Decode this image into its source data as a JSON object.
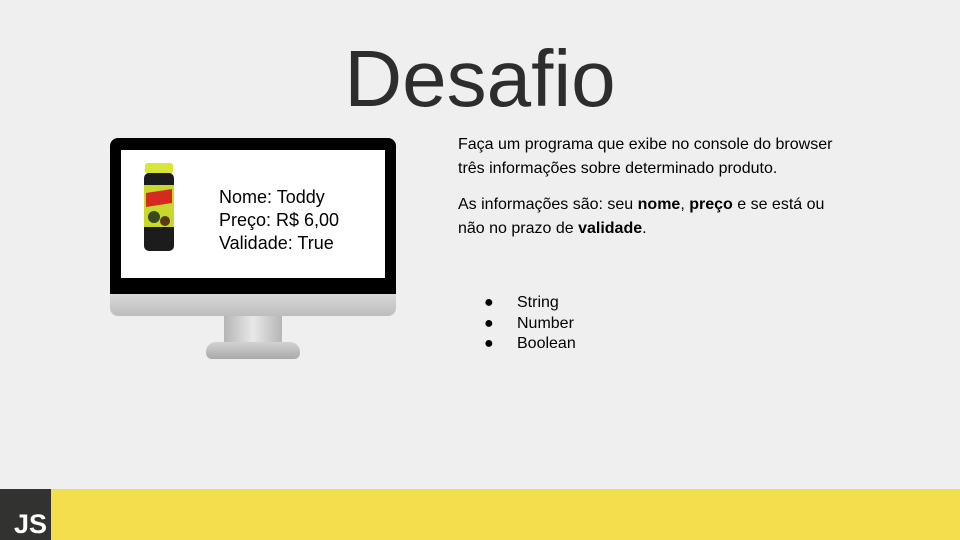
{
  "slide": {
    "title": "Desafio"
  },
  "monitor": {
    "product": {
      "name_line": "Nome: Toddy",
      "price_line": "Preço: R$ 6,00",
      "validity_line": "Validade: True",
      "jar_brand": "Toddy"
    }
  },
  "description": {
    "paragraph1": "Faça um programa que exibe no console do browser três informações sobre determinado produto.",
    "paragraph2": {
      "text_a": "As informações são: seu ",
      "bold_a": "nome",
      "text_b": ", ",
      "bold_b": "preço",
      "text_c": " e se está ou não no prazo de ",
      "bold_c": "validade",
      "text_d": "."
    }
  },
  "types": [
    {
      "bullet": "●",
      "label": "String"
    },
    {
      "bullet": "●",
      "label": "Number"
    },
    {
      "bullet": "●",
      "label": "Boolean"
    }
  ],
  "footer": {
    "logo_text": "JS",
    "bar_color": "#f3df4b",
    "logo_bg": "#323330"
  }
}
